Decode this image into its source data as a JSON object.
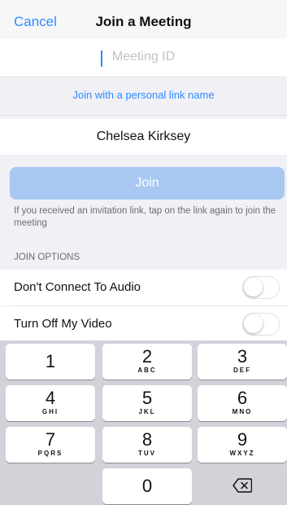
{
  "nav": {
    "cancel_label": "Cancel",
    "title": "Join a Meeting"
  },
  "meeting_id": {
    "placeholder": "Meeting ID",
    "value": ""
  },
  "personal_link": {
    "label": "Join with a personal link name"
  },
  "name_field": {
    "value": "Chelsea Kirksey"
  },
  "join_button": {
    "label": "Join",
    "enabled": false,
    "color": "#a8c8f2"
  },
  "info_text": "If you received an invitation link, tap on the link again to join the meeting",
  "join_options": {
    "header": "JOIN OPTIONS",
    "items": [
      {
        "label": "Don't Connect To Audio",
        "on": false
      },
      {
        "label": "Turn Off My Video",
        "on": false
      }
    ]
  },
  "keypad": {
    "keys": [
      {
        "digit": "1",
        "letters": ""
      },
      {
        "digit": "2",
        "letters": "ABC"
      },
      {
        "digit": "3",
        "letters": "DEF"
      },
      {
        "digit": "4",
        "letters": "GHI"
      },
      {
        "digit": "5",
        "letters": "JKL"
      },
      {
        "digit": "6",
        "letters": "MNO"
      },
      {
        "digit": "7",
        "letters": "PQRS"
      },
      {
        "digit": "8",
        "letters": "TUV"
      },
      {
        "digit": "9",
        "letters": "WXYZ"
      },
      {
        "digit": "0",
        "letters": ""
      }
    ],
    "backspace_icon": "backspace-icon"
  },
  "colors": {
    "accent": "#2d8cff",
    "background": "#f0f0f5"
  }
}
